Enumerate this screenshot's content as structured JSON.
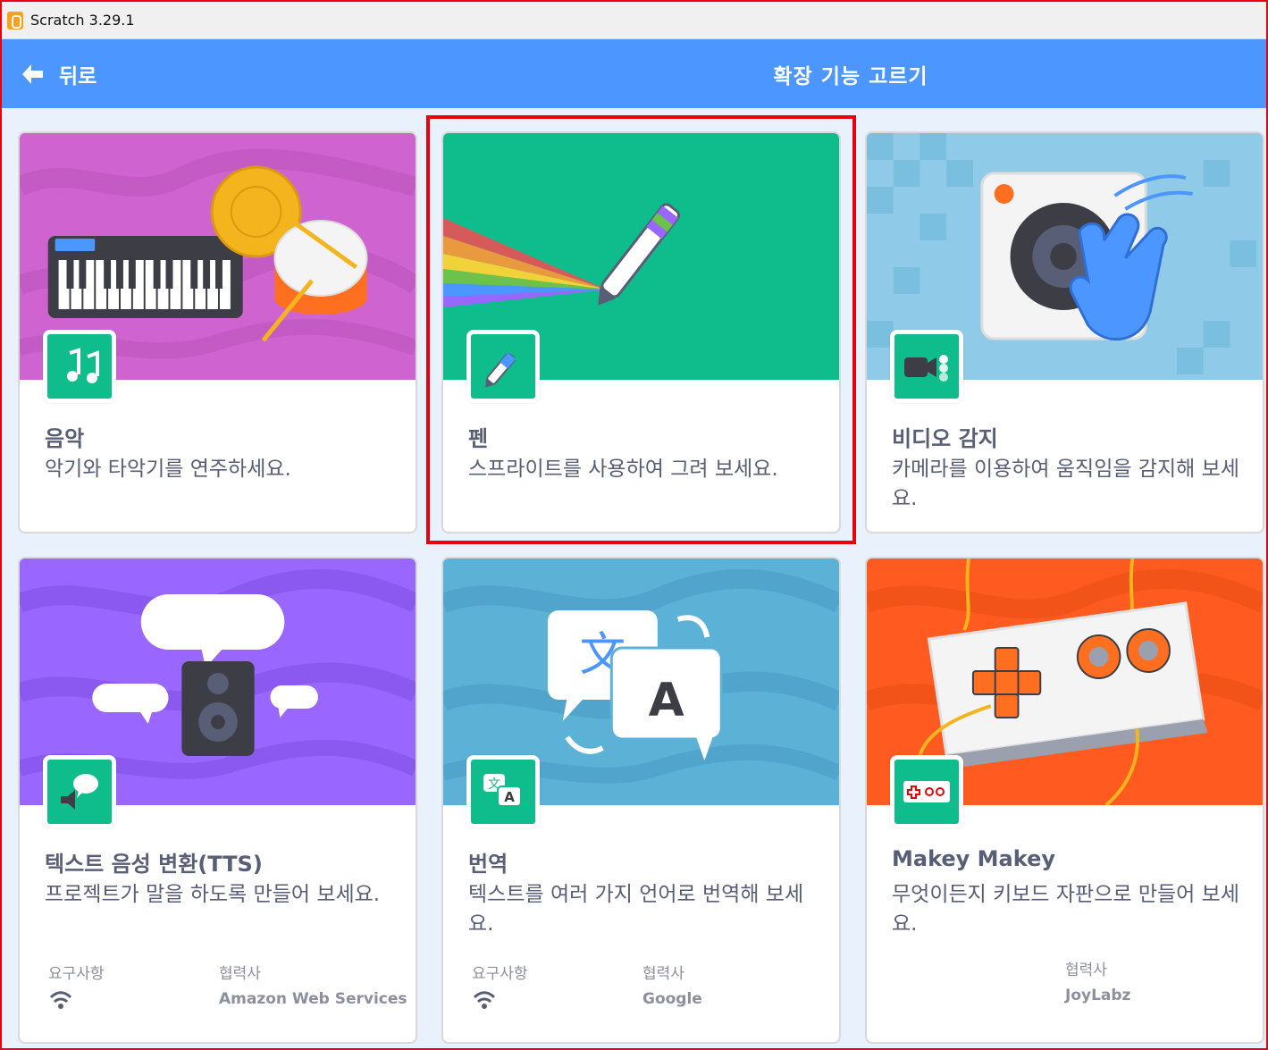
{
  "window": {
    "title": "Scratch 3.29.1"
  },
  "header": {
    "back_label": "뒤로",
    "title": "확장 기능 고르기"
  },
  "colors": {
    "header": "#4c97ff",
    "extension_icon_bg": "#0fbd8c",
    "highlight": "#e8000a"
  },
  "extensions": [
    {
      "name": "음악",
      "description": "악기와 타악기를 연주하세요.",
      "icon": "music-notes-icon"
    },
    {
      "name": "펜",
      "description": "스프라이트를 사용하여 그려 보세요.",
      "icon": "pen-icon",
      "highlighted": true
    },
    {
      "name": "비디오 감지",
      "description": "카메라를 이용하여 움직임을 감지해 보세요.",
      "icon": "video-camera-icon"
    },
    {
      "name": "텍스트 음성 변환(TTS)",
      "description": "프로젝트가 말을 하도록 만들어 보세요.",
      "icon": "speech-bubble-icon",
      "requirements_label": "요구사항",
      "requirement_icon": "wifi-icon",
      "collaborator_label": "협력사",
      "collaborator": "Amazon Web Services"
    },
    {
      "name": "번역",
      "description": "텍스트를 여러 가지 언어로 번역해 보세요.",
      "icon": "translate-icon",
      "requirements_label": "요구사항",
      "requirement_icon": "wifi-icon",
      "collaborator_label": "협력사",
      "collaborator": "Google"
    },
    {
      "name": "Makey Makey",
      "description": "무엇이든지 키보드 자판으로 만들어 보세요.",
      "icon": "makey-makey-icon",
      "collaborator_label": "협력사",
      "collaborator": "JoyLabz"
    }
  ]
}
